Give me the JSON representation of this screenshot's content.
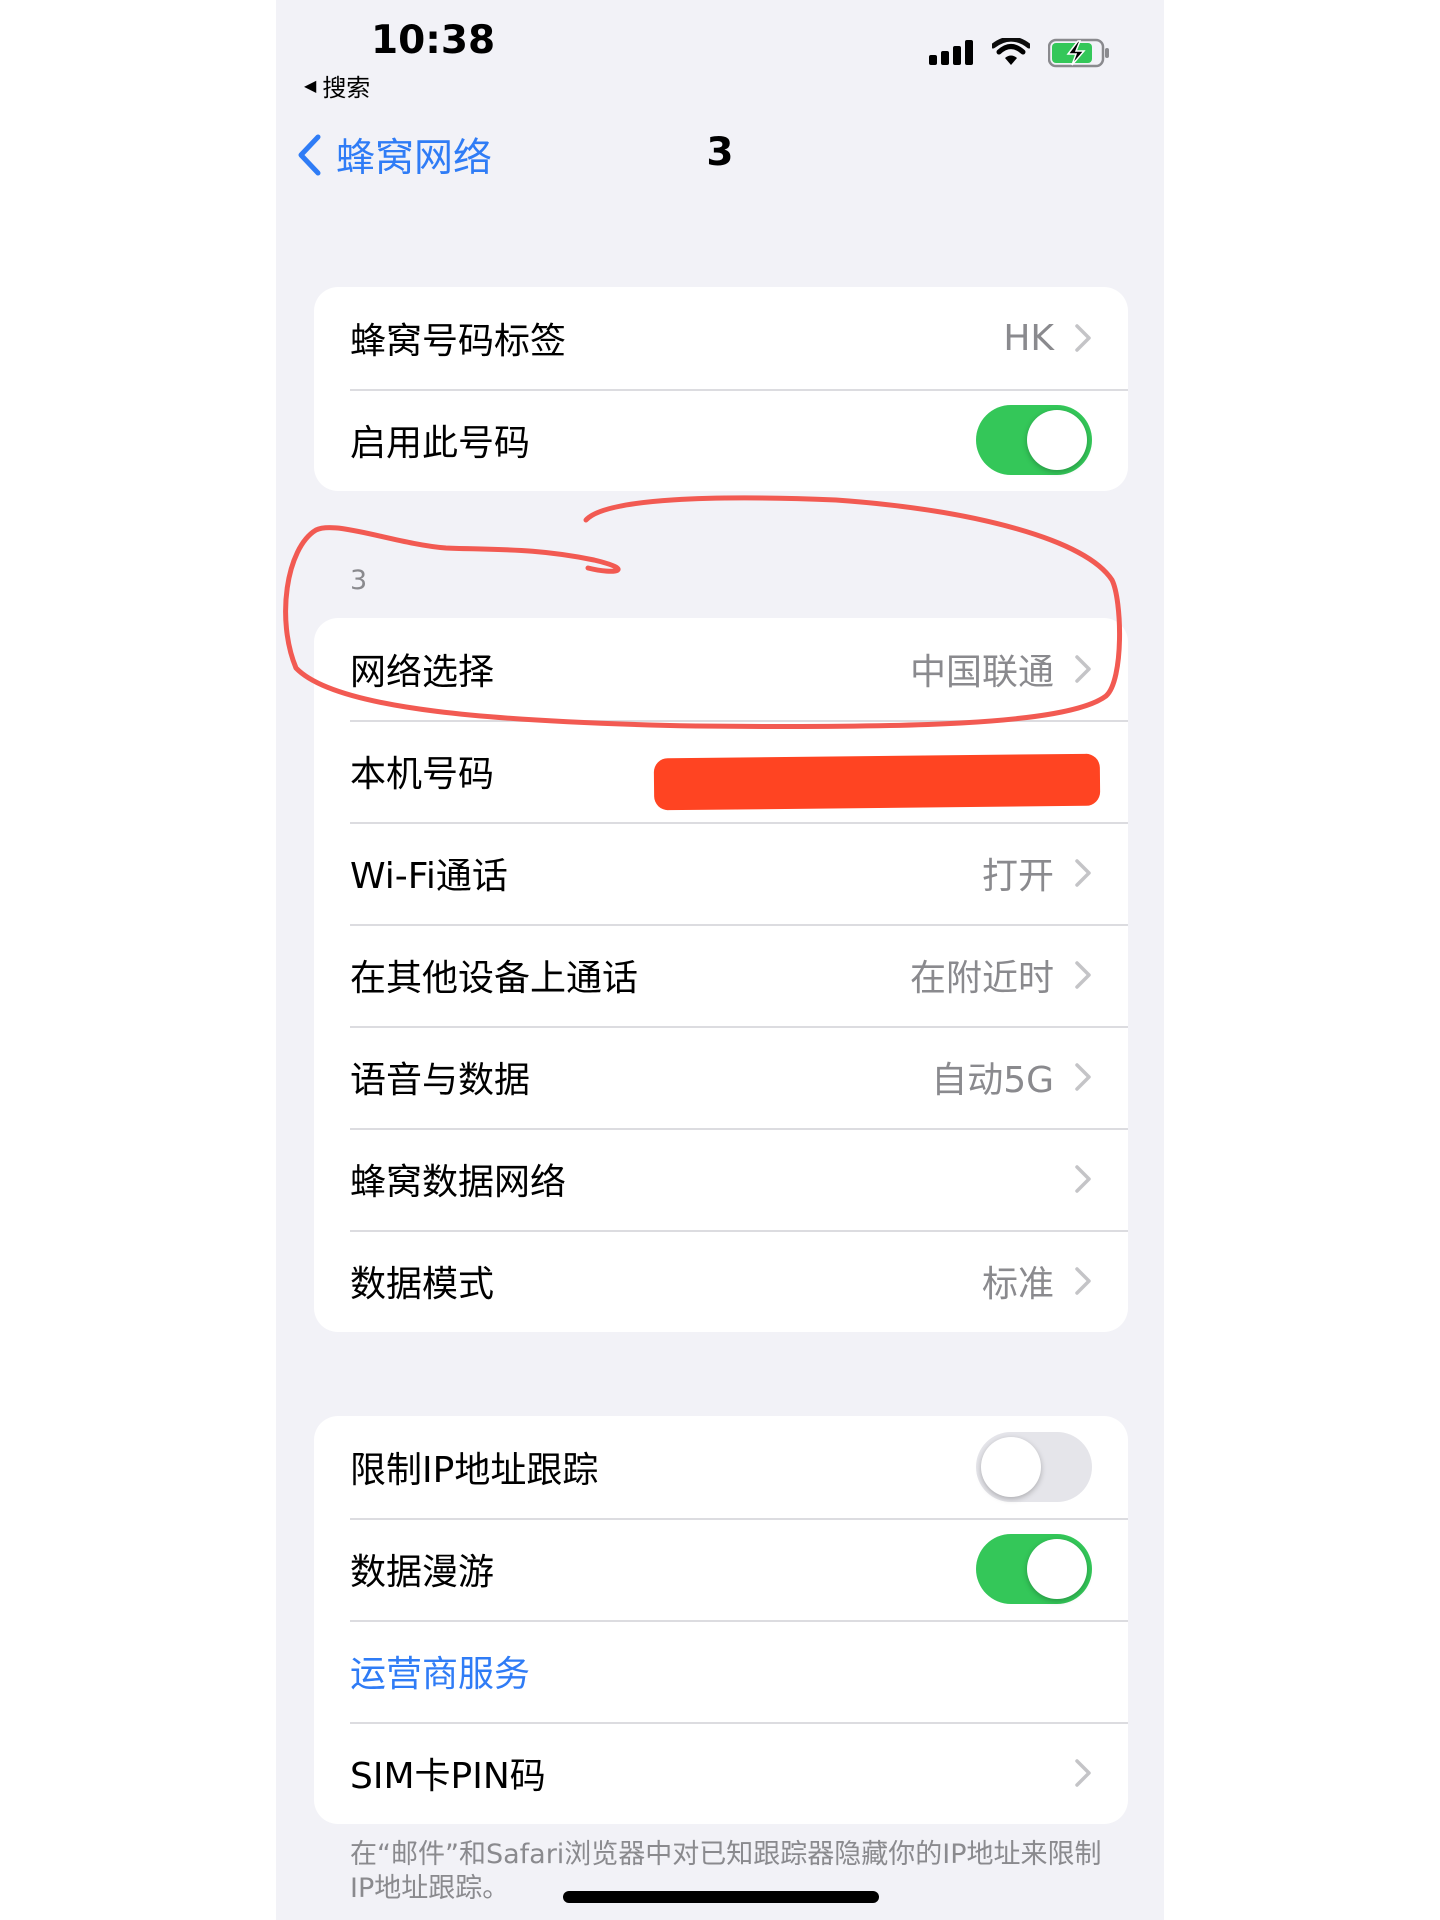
{
  "status_bar": {
    "time": "10:38",
    "back_app": "搜索",
    "icons": [
      "cellular-signal-icon",
      "wifi-icon",
      "battery-charging-icon"
    ]
  },
  "nav": {
    "back_label": "蜂窝网络",
    "title": "3"
  },
  "group1": {
    "rows": [
      {
        "label": "蜂窝号码标签",
        "value": "HK"
      },
      {
        "label": "启用此号码",
        "toggle": "on"
      }
    ]
  },
  "section_header": "3",
  "group2": {
    "rows": [
      {
        "label": "网络选择",
        "value": "中国联通"
      },
      {
        "label": "本机号码",
        "value": ""
      },
      {
        "label": "Wi‑Fi通话",
        "value": "打开"
      },
      {
        "label": "在其他设备上通话",
        "value": "在附近时"
      },
      {
        "label": "语音与数据",
        "value": "自动5G"
      },
      {
        "label": "蜂窝数据网络",
        "value": ""
      },
      {
        "label": "数据模式",
        "value": "标准"
      }
    ]
  },
  "group3": {
    "rows": [
      {
        "label": "限制IP地址跟踪",
        "toggle": "off"
      },
      {
        "label": "数据漫游",
        "toggle": "on"
      },
      {
        "label": "运营商服务"
      },
      {
        "label": "SIM卡PIN码"
      }
    ]
  },
  "footer_note": "在“邮件”和Safari浏览器中对已知跟踪器隐藏你的IP地址来限制IP地址跟踪。",
  "colors": {
    "accent": "#2f7cf6",
    "toggle_on": "#34c759",
    "annotation": "#f25a52",
    "redaction": "#ff4422"
  }
}
